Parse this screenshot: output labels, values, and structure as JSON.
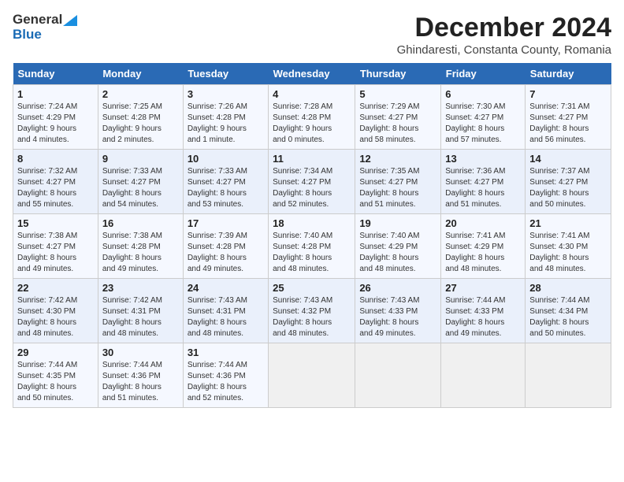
{
  "header": {
    "logo_general": "General",
    "logo_blue": "Blue",
    "month_title": "December 2024",
    "location": "Ghindaresti, Constanta County, Romania"
  },
  "weekdays": [
    "Sunday",
    "Monday",
    "Tuesday",
    "Wednesday",
    "Thursday",
    "Friday",
    "Saturday"
  ],
  "weeks": [
    [
      {
        "day": "1",
        "info": "Sunrise: 7:24 AM\nSunset: 4:29 PM\nDaylight: 9 hours\nand 4 minutes."
      },
      {
        "day": "2",
        "info": "Sunrise: 7:25 AM\nSunset: 4:28 PM\nDaylight: 9 hours\nand 2 minutes."
      },
      {
        "day": "3",
        "info": "Sunrise: 7:26 AM\nSunset: 4:28 PM\nDaylight: 9 hours\nand 1 minute."
      },
      {
        "day": "4",
        "info": "Sunrise: 7:28 AM\nSunset: 4:28 PM\nDaylight: 9 hours\nand 0 minutes."
      },
      {
        "day": "5",
        "info": "Sunrise: 7:29 AM\nSunset: 4:27 PM\nDaylight: 8 hours\nand 58 minutes."
      },
      {
        "day": "6",
        "info": "Sunrise: 7:30 AM\nSunset: 4:27 PM\nDaylight: 8 hours\nand 57 minutes."
      },
      {
        "day": "7",
        "info": "Sunrise: 7:31 AM\nSunset: 4:27 PM\nDaylight: 8 hours\nand 56 minutes."
      }
    ],
    [
      {
        "day": "8",
        "info": "Sunrise: 7:32 AM\nSunset: 4:27 PM\nDaylight: 8 hours\nand 55 minutes."
      },
      {
        "day": "9",
        "info": "Sunrise: 7:33 AM\nSunset: 4:27 PM\nDaylight: 8 hours\nand 54 minutes."
      },
      {
        "day": "10",
        "info": "Sunrise: 7:33 AM\nSunset: 4:27 PM\nDaylight: 8 hours\nand 53 minutes."
      },
      {
        "day": "11",
        "info": "Sunrise: 7:34 AM\nSunset: 4:27 PM\nDaylight: 8 hours\nand 52 minutes."
      },
      {
        "day": "12",
        "info": "Sunrise: 7:35 AM\nSunset: 4:27 PM\nDaylight: 8 hours\nand 51 minutes."
      },
      {
        "day": "13",
        "info": "Sunrise: 7:36 AM\nSunset: 4:27 PM\nDaylight: 8 hours\nand 51 minutes."
      },
      {
        "day": "14",
        "info": "Sunrise: 7:37 AM\nSunset: 4:27 PM\nDaylight: 8 hours\nand 50 minutes."
      }
    ],
    [
      {
        "day": "15",
        "info": "Sunrise: 7:38 AM\nSunset: 4:27 PM\nDaylight: 8 hours\nand 49 minutes."
      },
      {
        "day": "16",
        "info": "Sunrise: 7:38 AM\nSunset: 4:28 PM\nDaylight: 8 hours\nand 49 minutes."
      },
      {
        "day": "17",
        "info": "Sunrise: 7:39 AM\nSunset: 4:28 PM\nDaylight: 8 hours\nand 49 minutes."
      },
      {
        "day": "18",
        "info": "Sunrise: 7:40 AM\nSunset: 4:28 PM\nDaylight: 8 hours\nand 48 minutes."
      },
      {
        "day": "19",
        "info": "Sunrise: 7:40 AM\nSunset: 4:29 PM\nDaylight: 8 hours\nand 48 minutes."
      },
      {
        "day": "20",
        "info": "Sunrise: 7:41 AM\nSunset: 4:29 PM\nDaylight: 8 hours\nand 48 minutes."
      },
      {
        "day": "21",
        "info": "Sunrise: 7:41 AM\nSunset: 4:30 PM\nDaylight: 8 hours\nand 48 minutes."
      }
    ],
    [
      {
        "day": "22",
        "info": "Sunrise: 7:42 AM\nSunset: 4:30 PM\nDaylight: 8 hours\nand 48 minutes."
      },
      {
        "day": "23",
        "info": "Sunrise: 7:42 AM\nSunset: 4:31 PM\nDaylight: 8 hours\nand 48 minutes."
      },
      {
        "day": "24",
        "info": "Sunrise: 7:43 AM\nSunset: 4:31 PM\nDaylight: 8 hours\nand 48 minutes."
      },
      {
        "day": "25",
        "info": "Sunrise: 7:43 AM\nSunset: 4:32 PM\nDaylight: 8 hours\nand 48 minutes."
      },
      {
        "day": "26",
        "info": "Sunrise: 7:43 AM\nSunset: 4:33 PM\nDaylight: 8 hours\nand 49 minutes."
      },
      {
        "day": "27",
        "info": "Sunrise: 7:44 AM\nSunset: 4:33 PM\nDaylight: 8 hours\nand 49 minutes."
      },
      {
        "day": "28",
        "info": "Sunrise: 7:44 AM\nSunset: 4:34 PM\nDaylight: 8 hours\nand 50 minutes."
      }
    ],
    [
      {
        "day": "29",
        "info": "Sunrise: 7:44 AM\nSunset: 4:35 PM\nDaylight: 8 hours\nand 50 minutes."
      },
      {
        "day": "30",
        "info": "Sunrise: 7:44 AM\nSunset: 4:36 PM\nDaylight: 8 hours\nand 51 minutes."
      },
      {
        "day": "31",
        "info": "Sunrise: 7:44 AM\nSunset: 4:36 PM\nDaylight: 8 hours\nand 52 minutes."
      },
      {
        "day": "",
        "info": ""
      },
      {
        "day": "",
        "info": ""
      },
      {
        "day": "",
        "info": ""
      },
      {
        "day": "",
        "info": ""
      }
    ]
  ]
}
